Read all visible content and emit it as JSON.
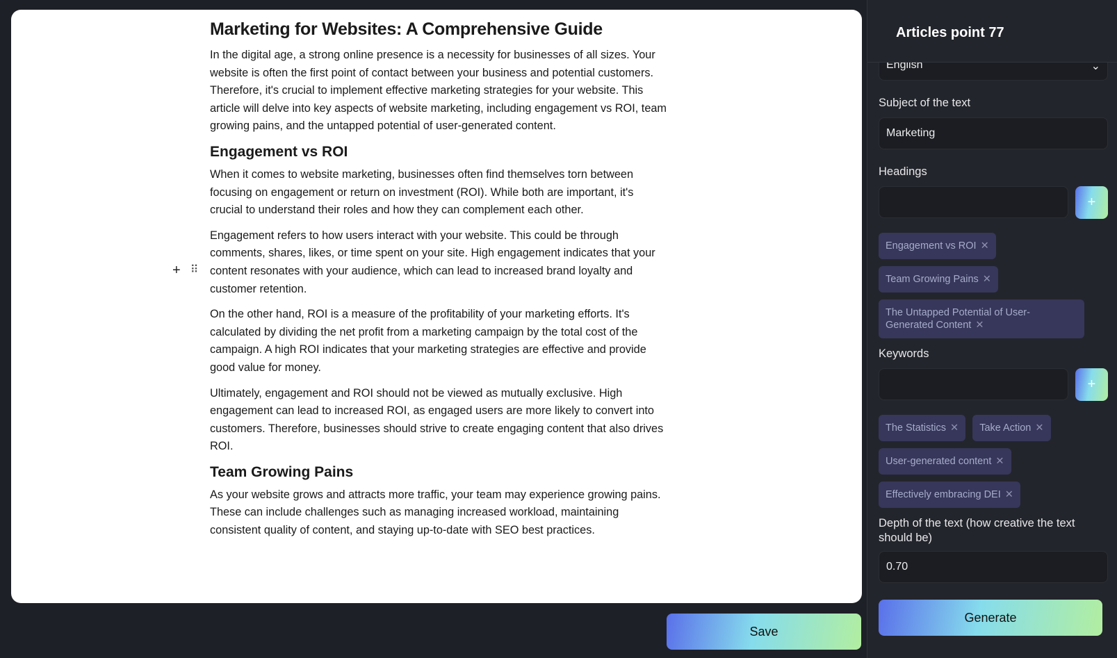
{
  "document": {
    "title": "Marketing for Websites: A Comprehensive Guide",
    "intro": "In the digital age, a strong online presence is a necessity for businesses of all sizes. Your website is often the first point of contact between your business and potential customers. Therefore, it's crucial to implement effective marketing strategies for your website. This article will delve into key aspects of website marketing, including engagement vs ROI, team growing pains, and the untapped potential of user-generated content.",
    "h_engagement": "Engagement vs ROI",
    "p1": "When it comes to website marketing, businesses often find themselves torn between focusing on engagement or return on investment (ROI). While both are important, it's crucial to understand their roles and how they can complement each other.",
    "p2": "Engagement refers to how users interact with your website. This could be through comments, shares, likes, or time spent on your site. High engagement indicates that your content resonates with your audience, which can lead to increased brand loyalty and customer retention.",
    "p3": "On the other hand, ROI is a measure of the profitability of your marketing efforts. It's calculated by dividing the net profit from a marketing campaign by the total cost of the campaign. A high ROI indicates that your marketing strategies are effective and provide good value for money.",
    "p4": "Ultimately, engagement and ROI should not be viewed as mutually exclusive. High engagement can lead to increased ROI, as engaged users are more likely to convert into customers. Therefore, businesses should strive to create engaging content that also drives ROI.",
    "h_team": "Team Growing Pains",
    "p5": "As your website grows and attracts more traffic, your team may experience growing pains. These can include challenges such as managing increased workload, maintaining consistent quality of content, and staying up-to-date with SEO best practices."
  },
  "handles": {
    "add": "+",
    "drag": "⠿"
  },
  "save_label": "Save",
  "sidebar": {
    "title": "Articles point 77",
    "language": "English",
    "subject_label": "Subject of the text",
    "subject_value": "Marketing",
    "headings_label": "Headings",
    "headings": [
      "Engagement vs ROI",
      "Team Growing Pains",
      "The Untapped Potential of User-Generated Content"
    ],
    "keywords_label": "Keywords",
    "keywords": [
      "The Statistics",
      "Take Action",
      "User-generated content",
      "Effectively embracing DEI"
    ],
    "depth_label": "Depth of the text (how creative the text should be)",
    "depth_value": "0.70",
    "generate_label": "Generate"
  },
  "colors": {
    "accent_gradient": [
      "#5a70ea",
      "#86dcec",
      "#b2eea0"
    ],
    "chip_bg": "#36375a"
  }
}
